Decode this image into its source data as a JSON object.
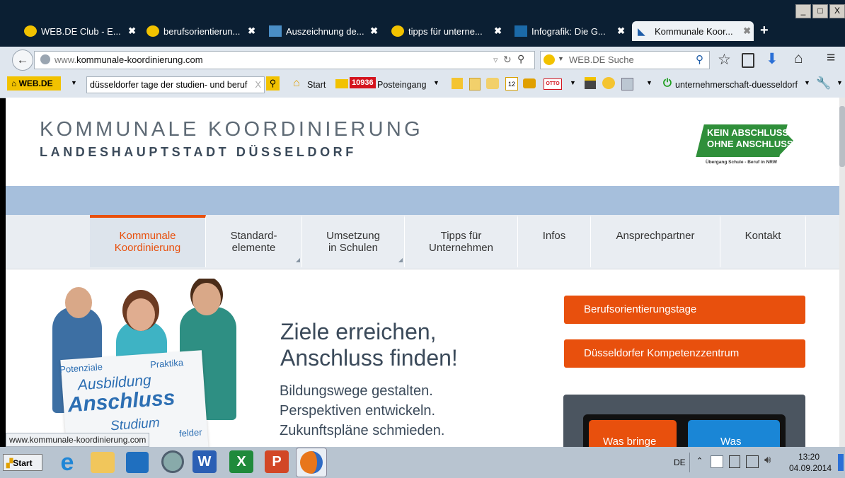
{
  "window": {
    "controls": [
      "_",
      "□",
      "X"
    ]
  },
  "tabs": [
    {
      "title": "WEB.DE Club - E...",
      "close": "✖"
    },
    {
      "title": "berufsorientierun...",
      "close": "✖"
    },
    {
      "title": "Auszeichnung de...",
      "close": "✖"
    },
    {
      "title": "tipps für unterne...",
      "close": "✖"
    },
    {
      "title": "Infografik: Die G...",
      "close": "✖"
    },
    {
      "title": "Kommunale Koor...",
      "close": "✖"
    }
  ],
  "new_tab": "+",
  "navbar": {
    "url_prefix": "www.",
    "url_domain": "kommunale-koordinierung.com",
    "search_placeholder": "WEB.DE Suche"
  },
  "toolbar": {
    "brand": "WEB.DE",
    "search_value": "düsseldorfer tage der studien- und beruf",
    "clear": "X",
    "start": "Start",
    "mail_count": "10936",
    "inbox": "Posteingang",
    "otto": "OTTO",
    "calendar_day": "12",
    "link": "unternehmerschaft-duesseldorf"
  },
  "site": {
    "title": "KOMMUNALE KOORDINIERUNG",
    "subtitle": "LANDESHAUPTSTADT DÜSSELDORF",
    "badge_line1": "KEIN ABSCHLUSS",
    "badge_line2": "OHNE ANSCHLUSS",
    "badge_line3": "Übergang Schule - Beruf in NRW",
    "menu": [
      {
        "label": "Kommunale\nKoordinierung"
      },
      {
        "label": "Standard-\nelemente"
      },
      {
        "label": "Umsetzung\nin Schulen"
      },
      {
        "label": "Tipps für\nUnternehmen"
      },
      {
        "label": "Infos"
      },
      {
        "label": "Ansprechpartner"
      },
      {
        "label": "Kontakt"
      }
    ],
    "headline1": "Ziele erreichen,",
    "headline2": "Anschluss finden!",
    "lines": [
      "Bildungswege gestalten.",
      "Perspektiven entwickeln.",
      "Zukunftspläne schmieden."
    ],
    "sign": {
      "w1": "Potenziale",
      "w2": "Praktika",
      "w3": "Ausbildung",
      "w4": "Anschluss",
      "w5": "Studium",
      "w6": "felder"
    },
    "buttons": [
      "Berufsorientierungstage",
      "Düsseldorfer Kompetenzzentrum"
    ],
    "tiles": [
      "Was bringe",
      "Was"
    ]
  },
  "status_url": "www.kommunale-koordinierung.com",
  "taskbar": {
    "start": "Start",
    "lang": "DE",
    "time": "13:20",
    "date": "04.09.2014"
  },
  "colors": {
    "accent_orange": "#e8500d",
    "menu_bar": "#e9edf2",
    "blue_band": "#a6bfdc"
  }
}
